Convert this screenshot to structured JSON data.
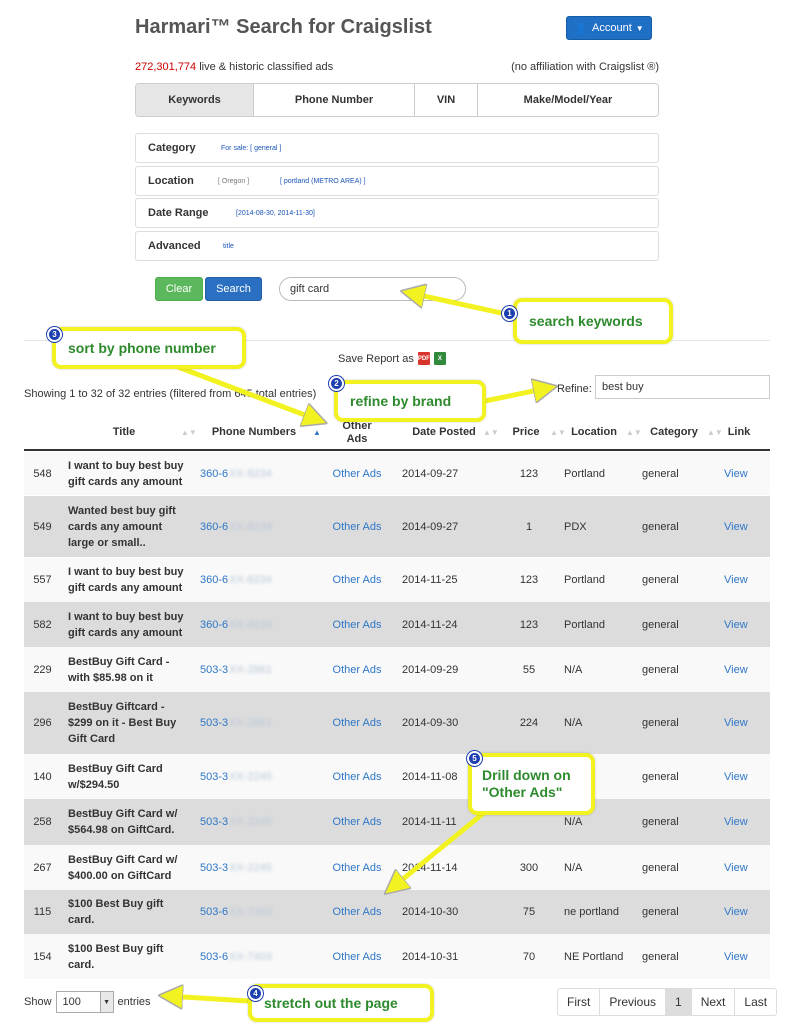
{
  "header": {
    "title": "Harmari™ Search for Craigslist",
    "account_label": "Account",
    "count": "272,301,774",
    "count_suffix": " live & historic classified ads",
    "affiliation": "(no affiliation with Craigslist ®)"
  },
  "tabs": [
    "Keywords",
    "Phone Number",
    "VIN",
    "Make/Model/Year"
  ],
  "filters": {
    "category": {
      "label": "Category",
      "value": "For sale: [ general ]"
    },
    "location": {
      "label": "Location",
      "state": "[ Oregon ]",
      "value": "[ portland (METRO AREA) ]"
    },
    "date_range": {
      "label": "Date Range",
      "value": "[2014-08-30, 2014-11-30]"
    },
    "advanced": {
      "label": "Advanced",
      "value": "title"
    }
  },
  "search": {
    "clear_label": "Clear",
    "search_label": "Search",
    "keywords": "gift card"
  },
  "report": {
    "save_label": "Save Report as"
  },
  "table_info": {
    "showing": "Showing 1 to 32 of 32 entries (filtered from 645 total entries)",
    "refine_label": "Refine:",
    "refine_value": "best buy"
  },
  "columns": [
    "Title",
    "Phone Numbers",
    "Other Ads",
    "Date Posted",
    "Price",
    "Location",
    "Category",
    "Link"
  ],
  "rows": [
    {
      "id": "548",
      "title": "I want to buy best buy gift cards any amount",
      "phone": "360-6",
      "phone_hidden": "XX-8234",
      "other": "Other Ads",
      "date": "2014-09-27",
      "price": "123",
      "loc": "Portland",
      "cat": "general",
      "link": "View"
    },
    {
      "id": "549",
      "title": "Wanted best buy gift cards any amount large or small..",
      "phone": "360-6",
      "phone_hidden": "XX-8234",
      "other": "Other Ads",
      "date": "2014-09-27",
      "price": "1",
      "loc": "PDX",
      "cat": "general",
      "link": "View"
    },
    {
      "id": "557",
      "title": "I want to buy best buy gift cards any amount",
      "phone": "360-6",
      "phone_hidden": "XX-8234",
      "other": "Other Ads",
      "date": "2014-11-25",
      "price": "123",
      "loc": "Portland",
      "cat": "general",
      "link": "View"
    },
    {
      "id": "582",
      "title": "I want to buy best buy gift cards any amount",
      "phone": "360-6",
      "phone_hidden": "XX-8234",
      "other": "Other Ads",
      "date": "2014-11-24",
      "price": "123",
      "loc": "Portland",
      "cat": "general",
      "link": "View"
    },
    {
      "id": "229",
      "title": "BestBuy Gift Card - with $85.98 on it",
      "phone": "503-3",
      "phone_hidden": "XX-2861",
      "other": "Other Ads",
      "date": "2014-09-29",
      "price": "55",
      "loc": "N/A",
      "cat": "general",
      "link": "View"
    },
    {
      "id": "296",
      "title": "BestBuy Giftcard - $299 on it - Best Buy Gift Card",
      "phone": "503-3",
      "phone_hidden": "XX-2861",
      "other": "Other Ads",
      "date": "2014-09-30",
      "price": "224",
      "loc": "N/A",
      "cat": "general",
      "link": "View"
    },
    {
      "id": "140",
      "title": "BestBuy Gift Card w/$294.50",
      "phone": "503-3",
      "phone_hidden": "XX-2245",
      "other": "Other Ads",
      "date": "2014-11-08",
      "price": "",
      "loc": "nd",
      "cat": "general",
      "link": "View"
    },
    {
      "id": "258",
      "title": "BestBuy Gift Card w/ $564.98 on GiftCard.",
      "phone": "503-3",
      "phone_hidden": "XX-2245",
      "other": "Other Ads",
      "date": "2014-11-11",
      "price": "",
      "loc": "N/A",
      "cat": "general",
      "link": "View"
    },
    {
      "id": "267",
      "title": "BestBuy Gift Card w/ $400.00 on GiftCard",
      "phone": "503-3",
      "phone_hidden": "XX-2245",
      "other": "Other Ads",
      "date": "2014-11-14",
      "price": "300",
      "loc": "N/A",
      "cat": "general",
      "link": "View"
    },
    {
      "id": "115",
      "title": "$100 Best Buy gift card.",
      "phone": "503-6",
      "phone_hidden": "XX-7403",
      "other": "Other Ads",
      "date": "2014-10-30",
      "price": "75",
      "loc": "ne portland",
      "cat": "general",
      "link": "View"
    },
    {
      "id": "154",
      "title": "$100 Best Buy gift card.",
      "phone": "503-6",
      "phone_hidden": "XX-7403",
      "other": "Other Ads",
      "date": "2014-10-31",
      "price": "70",
      "loc": "NE Portland",
      "cat": "general",
      "link": "View"
    }
  ],
  "footer": {
    "show_label": "Show",
    "entries_value": "100",
    "entries_label": "entries",
    "pager": [
      "First",
      "Previous",
      "1",
      "Next",
      "Last"
    ]
  },
  "callouts": [
    {
      "num": "1",
      "text": "search keywords"
    },
    {
      "num": "2",
      "text": "refine by brand"
    },
    {
      "num": "3",
      "text": "sort by phone number"
    },
    {
      "num": "4",
      "text": "stretch out the page"
    },
    {
      "num": "5",
      "text": "Drill down on \"Other Ads\""
    }
  ],
  "colors": {
    "accent": "#2f77c8",
    "callout_border": "#f2f220",
    "callout_text": "#2d8a2d",
    "count": "#cc0000"
  }
}
